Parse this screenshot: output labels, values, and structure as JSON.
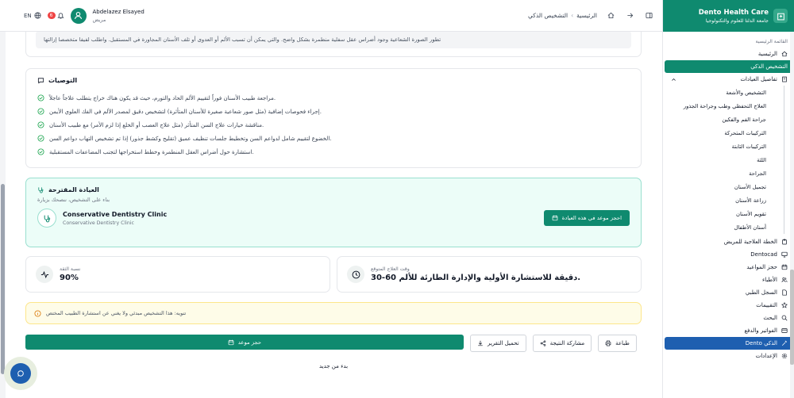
{
  "topbar": {
    "lang": "EN",
    "notif_count": "6",
    "user_name": "Abdelazez Elsayed",
    "user_role": "مريض",
    "crumb_home": "الرئيسية",
    "crumb_current": "التشخيص الذكي"
  },
  "findings_partial_text": "تطور الصورة الشعاعية وجود أضراس عقل سفلية منطمرة بشكل واضح. والتي يمكن أن تسبب الألم أو العدوى أو تلف الأسنان المجاورة في المستقبل. واطلب لفيفا متخصصا إزالتها",
  "recommendations": {
    "title": "التوصيات",
    "items": [
      "مراجعة طبيب الأسنان فوراً لتقييم الألم الحاد والتورم، حيث قد يكون هناك خراج يتطلب علاجاً عاجلاً.",
      "إجراء فحوصات إضافية (مثل صور شعاعية صغيرة للأسنان المتأثرة) لتشخيص دقيق لمصدر الألم في الفك العلوي الأيمن.",
      "مناقشة خيارات علاج السن المتأثر (مثل علاج العصب أو الخلع إذا لزم الأمر) مع طبيب الأسنان.",
      "الخضوع لتقييم شامل لدواعم السن وتخطيط جلسات تنظيف عميق (تقليح وكشط جذور) إذا تم تشخيص التهاب دواعم السن.",
      "استشارة حول أضراس العقل المنطمرة وخطط استخراجها لتجنب المضاعفات المستقبلية."
    ]
  },
  "clinic": {
    "title": "العيادة المقترحة",
    "subtitle": "بناء على التشخيص، ننصحك بزيارة",
    "name": "Conservative Dentistry Clinic",
    "name_sub": "Conservative Dentistry Clinic",
    "book_label": "احجز موعد في هذه العيادة"
  },
  "stats": {
    "confidence_label": "نسبة الثقة",
    "confidence_value": "90%",
    "time_label": "وقت العلاج المتوقع",
    "time_value": "30-60 دقيقة للاستشارة الأولية والإدارة الطارئة للألم."
  },
  "notice": "تنويه: هذا التشخيص مبدئي ولا يغني عن استشارة الطبيب المختص",
  "actions": {
    "book": "حجز موعد",
    "download": "تحميل التقرير",
    "share": "مشاركة النتيجة",
    "print": "طباعة"
  },
  "new_diagnosis": "بدء من جديد",
  "sidebar": {
    "brand_title": "Dento Health Care",
    "brand_sub": "جامعة الدلتا للعلوم والتكنولوجيا",
    "section_title": "القائمة الرئيسية",
    "home": "الرئيسية",
    "smart_diagnosis": "التشخيص الذكي",
    "clinic_details": "تفاصيل العيادات",
    "clinics": [
      "التشخيص والأشعة",
      "العلاج التحفظي وطب وجراحة الجذور",
      "جراحة الفم والفكين",
      "التركيبات المتحركة",
      "التركيبات الثابتة",
      "اللثة",
      "الجراحة",
      "تجميل الأسنان",
      "زراعة الأسنان",
      "تقويم الأسنان",
      "أسنان الأطفال"
    ],
    "treatment_plan": "الخطة العلاجية للمريض",
    "dentocad": "Dentocad",
    "appointments": "حجز المواعيد",
    "doctors": "الأطباء",
    "medical_record": "السجل الطبي",
    "reviews": "التقييمات",
    "search": "البحث",
    "billing": "الفواتير والدفع",
    "dento_ai": "Dento الذكي",
    "settings": "الإعدادات"
  }
}
